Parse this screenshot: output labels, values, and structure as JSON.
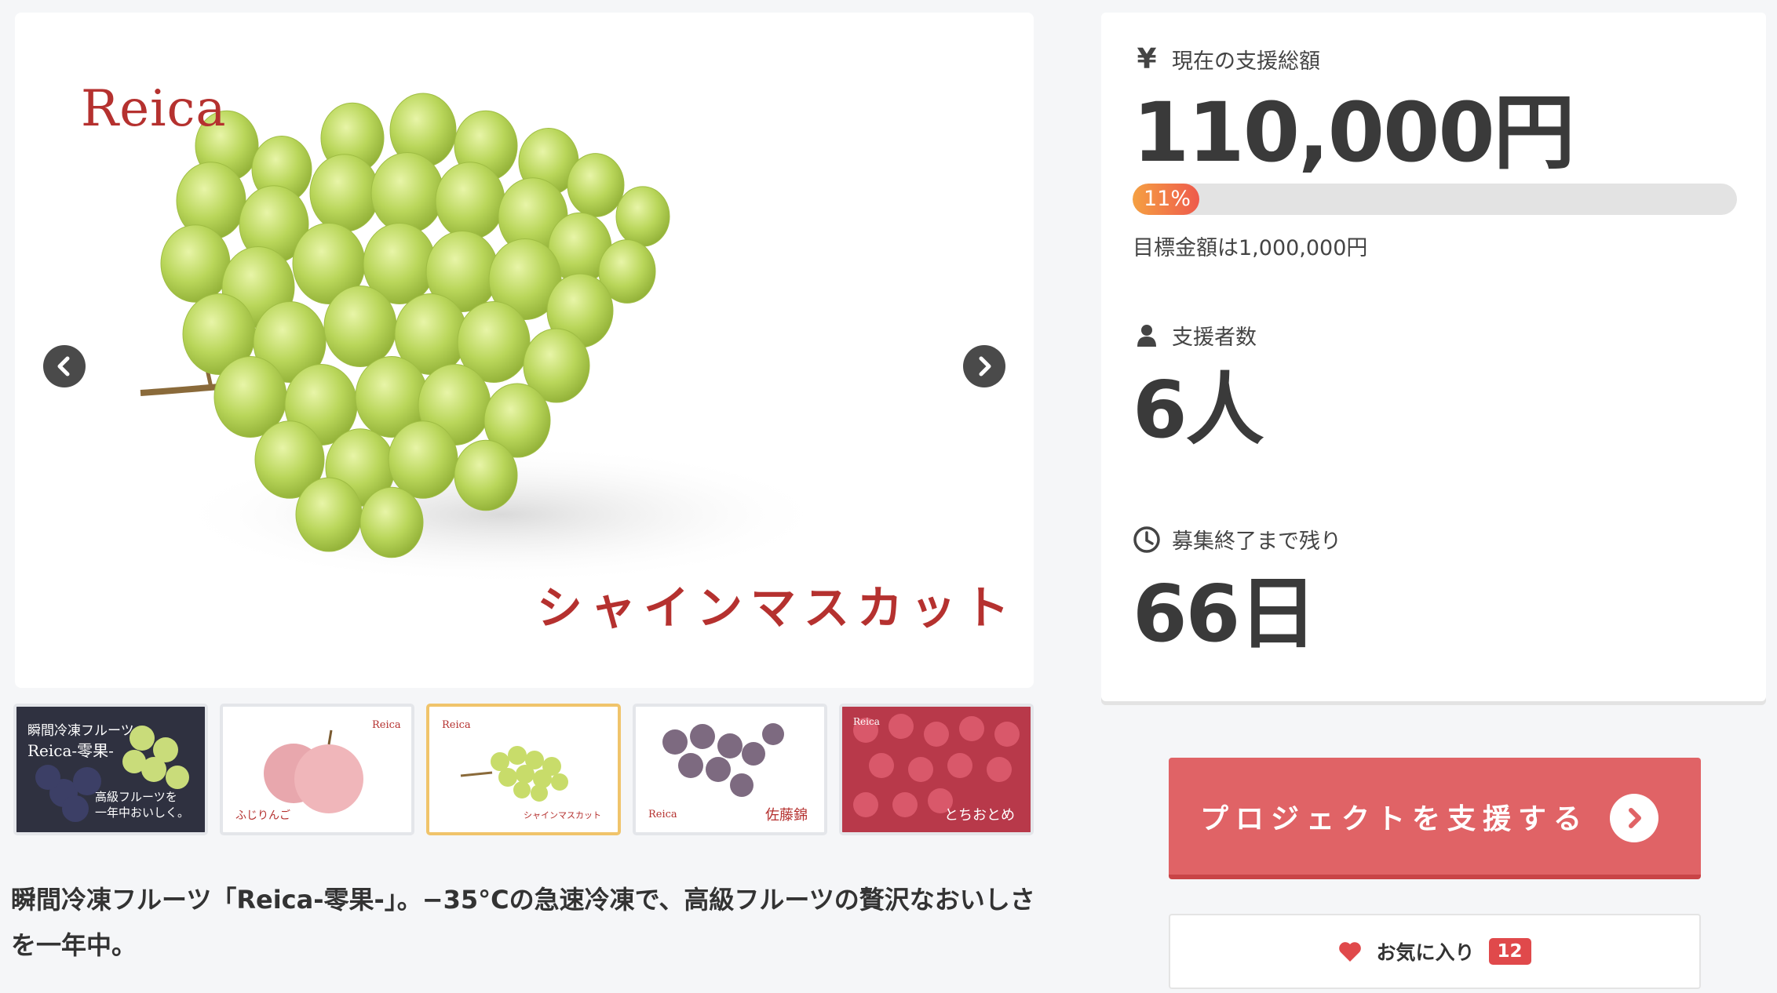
{
  "gallery": {
    "brand": "Reica",
    "variety": "シャインマスカット",
    "prev_icon": "chevron-left-icon",
    "next_icon": "chevron-right-icon",
    "thumbnails": [
      {
        "line1": "瞬間冷凍フルーツ",
        "line2": "Reica-零果-",
        "line3": "高級フルーツを",
        "line4": "一年中おいしく。"
      },
      {
        "brand": "Reica",
        "caption": "ふじりんご"
      },
      {
        "brand": "Reica",
        "caption": "シャインマスカット"
      },
      {
        "brand": "Reica",
        "caption": "佐藤錦"
      },
      {
        "brand": "Reica",
        "caption": "とちおとめ"
      }
    ]
  },
  "description": "瞬間冷凍フルーツ「Reica-零果-」。−35°Cの急速冷凍で、高級フルーツの贅沢なおいしさを一年中。",
  "stats": {
    "funding": {
      "icon": "yen-icon",
      "label": "現在の支援総額",
      "amount": "110,000円",
      "progress_percent": 11,
      "progress_label": "11%",
      "goal_text": "目標金額は1,000,000円"
    },
    "backers": {
      "icon": "person-icon",
      "label": "支援者数",
      "value": "6人"
    },
    "remaining": {
      "icon": "clock-icon",
      "label": "募集終了まで残り",
      "value": "66日"
    }
  },
  "actions": {
    "support_label": "プロジェクトを支援する",
    "support_icon": "chevron-right-circle-icon",
    "favorite_label": "お気に入り",
    "favorite_icon": "heart-icon",
    "favorite_count": "12"
  },
  "colors": {
    "accent": "#e06366",
    "brand_red": "#b5312f",
    "progress_start": "#f5a042",
    "progress_end": "#ee5a4c",
    "badge": "#e0494b",
    "active_thumb": "#f0c46b"
  }
}
